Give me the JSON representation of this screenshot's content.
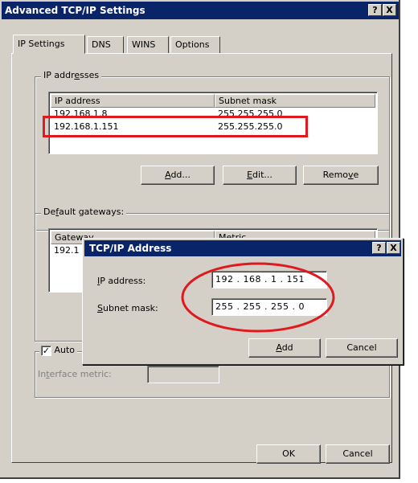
{
  "window": {
    "title": "Advanced TCP/IP Settings",
    "help_btn": "?",
    "close_btn": "X"
  },
  "tabs": [
    {
      "label": "IP Settings",
      "active": true
    },
    {
      "label": "DNS"
    },
    {
      "label": "WINS"
    },
    {
      "label": "Options"
    }
  ],
  "ip_addresses": {
    "group_label_pre": "IP addr",
    "group_label_ul": "e",
    "group_label_post": "sses",
    "columns": [
      "IP address",
      "Subnet mask"
    ],
    "rows": [
      {
        "ip": "192.168.1.8",
        "mask": "255.255.255.0"
      },
      {
        "ip": "192.168.1.151",
        "mask": "255.255.255.0"
      }
    ],
    "buttons": {
      "add_ul": "A",
      "add_rest": "dd...",
      "edit_ul": "E",
      "edit_rest": "dit...",
      "remove_pre": "Remo",
      "remove_ul": "v",
      "remove_post": "e"
    }
  },
  "default_gateways": {
    "group_label_pre": "De",
    "group_label_ul": "f",
    "group_label_post": "ault gateways:",
    "columns": [
      "Gateway",
      "Metric"
    ],
    "row_partial": "192.1"
  },
  "automatic_metric": {
    "label": "Auto",
    "checked": true,
    "interface_metric_pre": "In",
    "interface_metric_ul": "t",
    "interface_metric_post": "erface metric:"
  },
  "footer": {
    "ok": "OK",
    "cancel": "Cancel"
  },
  "dialog": {
    "title": "TCP/IP Address",
    "help_btn": "?",
    "close_btn": "X",
    "ip_label_ul": "I",
    "ip_label_rest": "P address:",
    "ip_value": "192 . 168 .  1  . 151",
    "mask_label_ul": "S",
    "mask_label_rest": "ubnet mask:",
    "mask_value": "255 . 255 . 255 .  0",
    "add_ul": "A",
    "add_rest": "dd",
    "cancel": "Cancel"
  },
  "annotation_colors": {
    "highlight": "#e0191e",
    "titlebar": "#0a246a",
    "window_bg": "#d4d0c8"
  }
}
